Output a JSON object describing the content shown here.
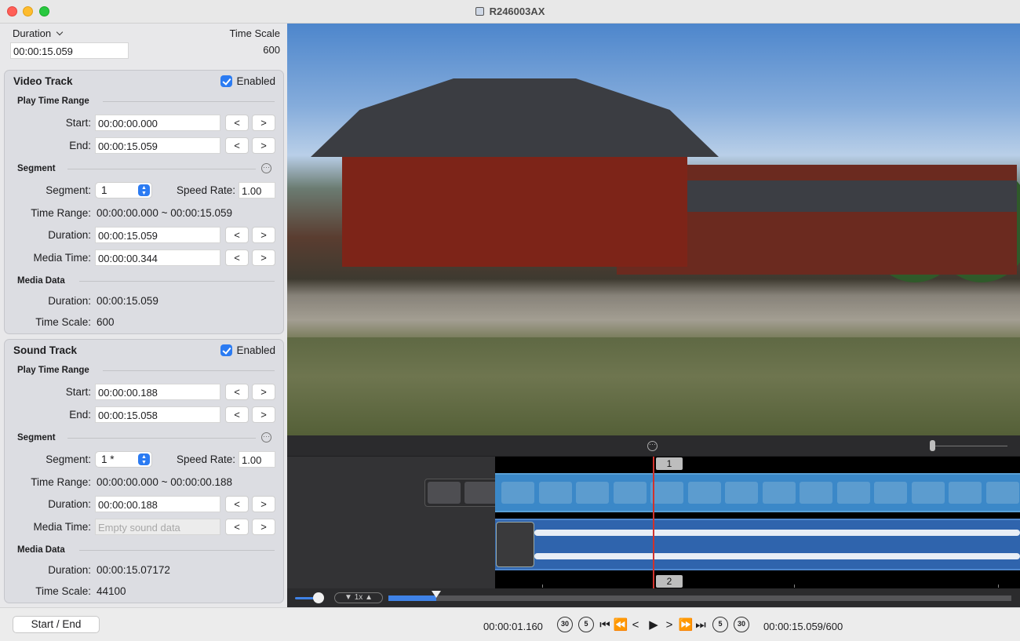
{
  "window": {
    "title": "R246003AX"
  },
  "header": {
    "duration_popup_label": "Duration",
    "duration_value": "00:00:15.059",
    "time_scale_label": "Time Scale",
    "time_scale_value": "600"
  },
  "video_track": {
    "title": "Video Track",
    "enabled_label": "Enabled",
    "enabled": true,
    "play_time_range_label": "Play Time Range",
    "start_label": "Start:",
    "start_value": "00:00:00.000",
    "end_label": "End:",
    "end_value": "00:00:15.059",
    "segment_section_label": "Segment",
    "segment_label": "Segment:",
    "segment_value": "1",
    "speed_rate_label": "Speed Rate:",
    "speed_rate_value": "1.00",
    "time_range_label": "Time Range:",
    "time_range_value": "00:00:00.000 ~ 00:00:15.059",
    "duration_label": "Duration:",
    "duration_value": "00:00:15.059",
    "media_time_label": "Media Time:",
    "media_time_value": "00:00:00.344",
    "media_data_label": "Media Data",
    "md_duration_label": "Duration:",
    "md_duration_value": "00:00:15.059",
    "md_time_scale_label": "Time Scale:",
    "md_time_scale_value": "600"
  },
  "sound_track": {
    "title": "Sound Track",
    "enabled_label": "Enabled",
    "enabled": true,
    "play_time_range_label": "Play Time Range",
    "start_label": "Start:",
    "start_value": "00:00:00.188",
    "end_label": "End:",
    "end_value": "00:00:15.058",
    "segment_section_label": "Segment",
    "segment_label": "Segment:",
    "segment_value": "1 *",
    "speed_rate_label": "Speed Rate:",
    "speed_rate_value": "1.00",
    "time_range_label": "Time Range:",
    "time_range_value": "00:00:00.000 ~ 00:00:00.188",
    "duration_label": "Duration:",
    "duration_value": "00:00:00.188",
    "media_time_label": "Media Time:",
    "media_time_placeholder": "Empty sound data",
    "media_data_label": "Media Data",
    "md_duration_label": "Duration:",
    "md_duration_value": "00:00:15.07172",
    "md_time_scale_label": "Time Scale:",
    "md_time_scale_value": "44100"
  },
  "buttons": {
    "prev": "<",
    "next": ">"
  },
  "timeline": {
    "marker_1": "1",
    "marker_2": "2",
    "rate_label": "1x",
    "rate_down": "▼",
    "rate_up": "▲",
    "progress_fraction": 0.077
  },
  "bottom": {
    "start_end_button": "Start / End",
    "current_time": "00:00:01.160",
    "end_time": "00:00:15.059/600",
    "skip_back_30": "30",
    "skip_back_5": "5",
    "skip_fwd_5": "5",
    "skip_fwd_30": "30"
  },
  "icons": [
    "doc-icon",
    "chevron-down-icon",
    "checkbox-icon",
    "more-icon",
    "stepper-arrows-icon",
    "playhead-icon",
    "volume-knob-icon",
    "skip-back-30-icon",
    "skip-back-5-icon",
    "go-to-start-icon",
    "rewind-icon",
    "step-back-icon",
    "play-icon",
    "step-forward-icon",
    "fast-forward-icon",
    "go-to-end-icon",
    "skip-forward-5-icon",
    "skip-forward-30-icon"
  ],
  "colors": {
    "accent": "#2b7bf2",
    "video_track": "#3b88c8",
    "audio_track": "#2f64ad",
    "playhead": "#d1322c"
  }
}
